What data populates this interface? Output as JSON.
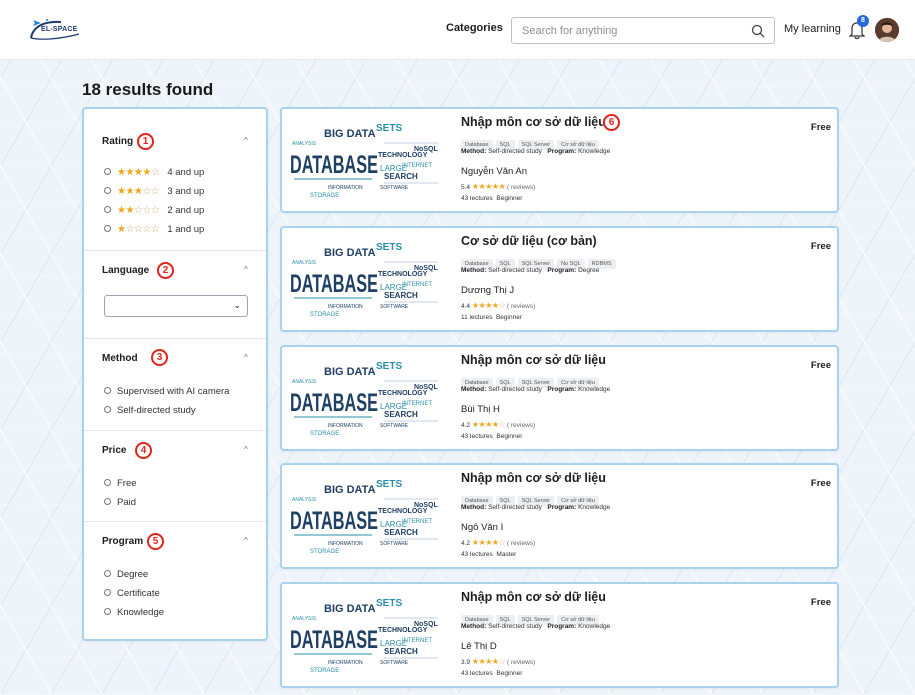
{
  "header": {
    "logo_text": "EL-SPACE",
    "categories_label": "Categories",
    "search_placeholder": "Search for anything",
    "my_learning_label": "My learning",
    "notification_count": "8"
  },
  "results": {
    "count_text": "18 results found"
  },
  "filters": {
    "rating": {
      "title": "Rating",
      "marker": "1",
      "options": [
        {
          "stars": 4,
          "label": "4 and up"
        },
        {
          "stars": 3,
          "label": "3 and up"
        },
        {
          "stars": 2,
          "label": "2 and up"
        },
        {
          "stars": 1,
          "label": "1 and up"
        }
      ]
    },
    "language": {
      "title": "Language",
      "marker": "2",
      "selected": ""
    },
    "method": {
      "title": "Method",
      "marker": "3",
      "options": [
        "Supervised with AI camera",
        "Self-directed study"
      ]
    },
    "price": {
      "title": "Price",
      "marker": "4",
      "options": [
        "Free",
        "Paid"
      ]
    },
    "program": {
      "title": "Program",
      "marker": "5",
      "options": [
        "Degree",
        "Certificate",
        "Knowledge"
      ]
    }
  },
  "course_marker": "6",
  "courses": [
    {
      "title": "Nhập môn cơ sở dữ liệu",
      "tags": [
        "Database",
        "SQL",
        "SQL Server",
        "Cơ sở dữ liệu"
      ],
      "method_label": "Method:",
      "method": "Self-directed study",
      "program_label": "Program:",
      "program": "Knowledge",
      "instructor": "Nguyễn Văn An",
      "rating": "5.4",
      "stars": 5,
      "reviews": "( reviews)",
      "lectures": "43 lectures",
      "level": "Beginner",
      "price": "Free"
    },
    {
      "title": "Cơ sở dữ liệu (cơ bản)",
      "tags": [
        "Database",
        "SQL",
        "SQL Server",
        "No SQL",
        "RDBMS"
      ],
      "method_label": "Method:",
      "method": "Self-directed study",
      "program_label": "Program:",
      "program": "Degree",
      "instructor": "Dương Thị J",
      "rating": "4.4",
      "stars": 4,
      "reviews": "( reviews)",
      "lectures": "11 lectures",
      "level": "Beginner",
      "price": "Free"
    },
    {
      "title": "Nhập môn cơ sở dữ liệu",
      "tags": [
        "Database",
        "SQL",
        "SQL Server",
        "Cơ sở dữ liệu"
      ],
      "method_label": "Method:",
      "method": "Self-directed study",
      "program_label": "Program:",
      "program": "Knowledge",
      "instructor": "Bùi Thị H",
      "rating": "4.2",
      "stars": 4,
      "reviews": "( reviews)",
      "lectures": "43 lectures",
      "level": "Beginner",
      "price": "Free"
    },
    {
      "title": "Nhập môn cơ sở dữ liệu",
      "tags": [
        "Database",
        "SQL",
        "SQL Server",
        "Cơ sở dữ liệu"
      ],
      "method_label": "Method:",
      "method": "Self-directed study",
      "program_label": "Program:",
      "program": "Knowledge",
      "instructor": "Ngô Văn I",
      "rating": "4.2",
      "stars": 4,
      "reviews": "( reviews)",
      "lectures": "43 lectures",
      "level": "Master",
      "price": "Free"
    },
    {
      "title": "Nhập môn cơ sở dữ liệu",
      "tags": [
        "Database",
        "SQL",
        "SQL Server",
        "Cơ sở dữ liệu"
      ],
      "method_label": "Method:",
      "method": "Self-directed study",
      "program_label": "Program:",
      "program": "Knowledge",
      "instructor": "Lê Thị D",
      "rating": "3.9",
      "stars": 3.5,
      "reviews": "( reviews)",
      "lectures": "43 lectures",
      "level": "Beginner",
      "price": "Free"
    }
  ],
  "thumbnail": {
    "main_word": "DATABASE",
    "words": [
      "BIG DATA",
      "SETS",
      "TECHNOLOGY",
      "INTERNET",
      "SEARCH",
      "LARGE",
      "STORAGE",
      "INFORMATION",
      "SOFTWARE",
      "ANALYSIS",
      "NoSQL"
    ]
  },
  "colors": {
    "accent": "#a9d2ef",
    "star": "#f0a51c",
    "marker": "#e0241c",
    "badge": "#2868d8",
    "thumb_dark": "#1f3f64",
    "thumb_teal": "#2a8fa8"
  }
}
